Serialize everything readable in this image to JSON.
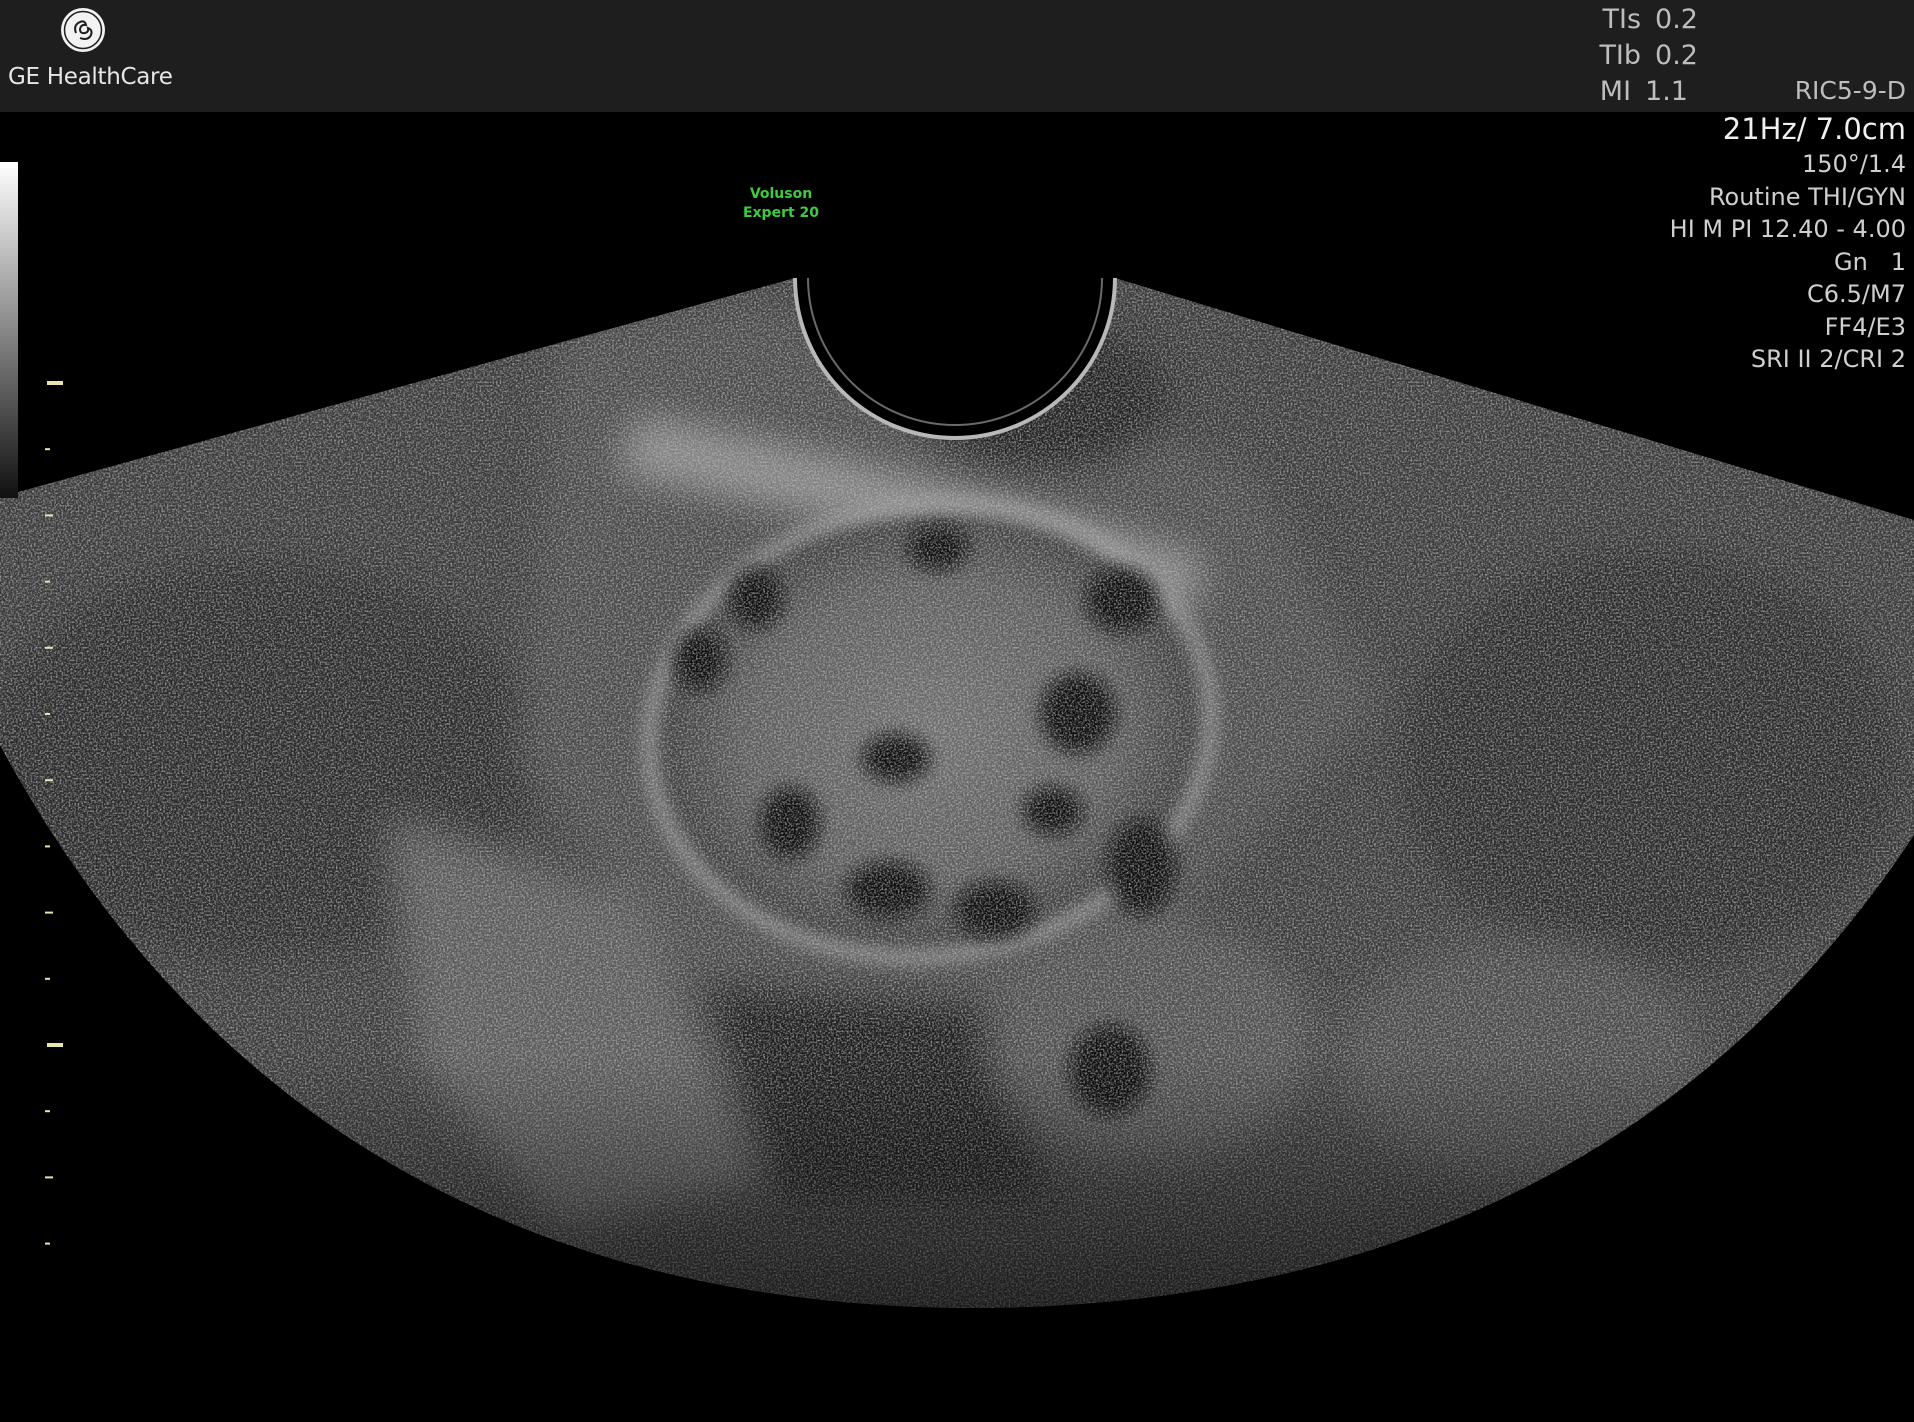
{
  "header": {
    "logo_mark": "GE monogram",
    "logo_text": "GE HealthCare"
  },
  "indices": [
    {
      "label": "TIs",
      "value": "0.2"
    },
    {
      "label": "TIb",
      "value": "0.2"
    },
    {
      "label": "MI",
      "value": "1.1"
    }
  ],
  "probe": "RIC5-9-D",
  "params": {
    "frame_depth": "21Hz/ 7.0cm",
    "angle": "150°/1.4",
    "preset": "Routine THI/GYN",
    "harmonics": "HI M PI 12.40 - 4.00",
    "gain": "Gn   1",
    "compression": "C6.5/M7",
    "filter": "FF4/E3",
    "sri": "SRI II 2/CRI 2"
  },
  "brand": {
    "line1": "Voluson",
    "line2": "Expert 20"
  },
  "icons": {
    "logo": "ge-logo-icon",
    "grayscale": "grayscale-bar-icon"
  },
  "colors": {
    "header_bg": "#1e1e1e",
    "brand_text": "#3dcc3d",
    "depth_marker": "#e8e6b0"
  }
}
